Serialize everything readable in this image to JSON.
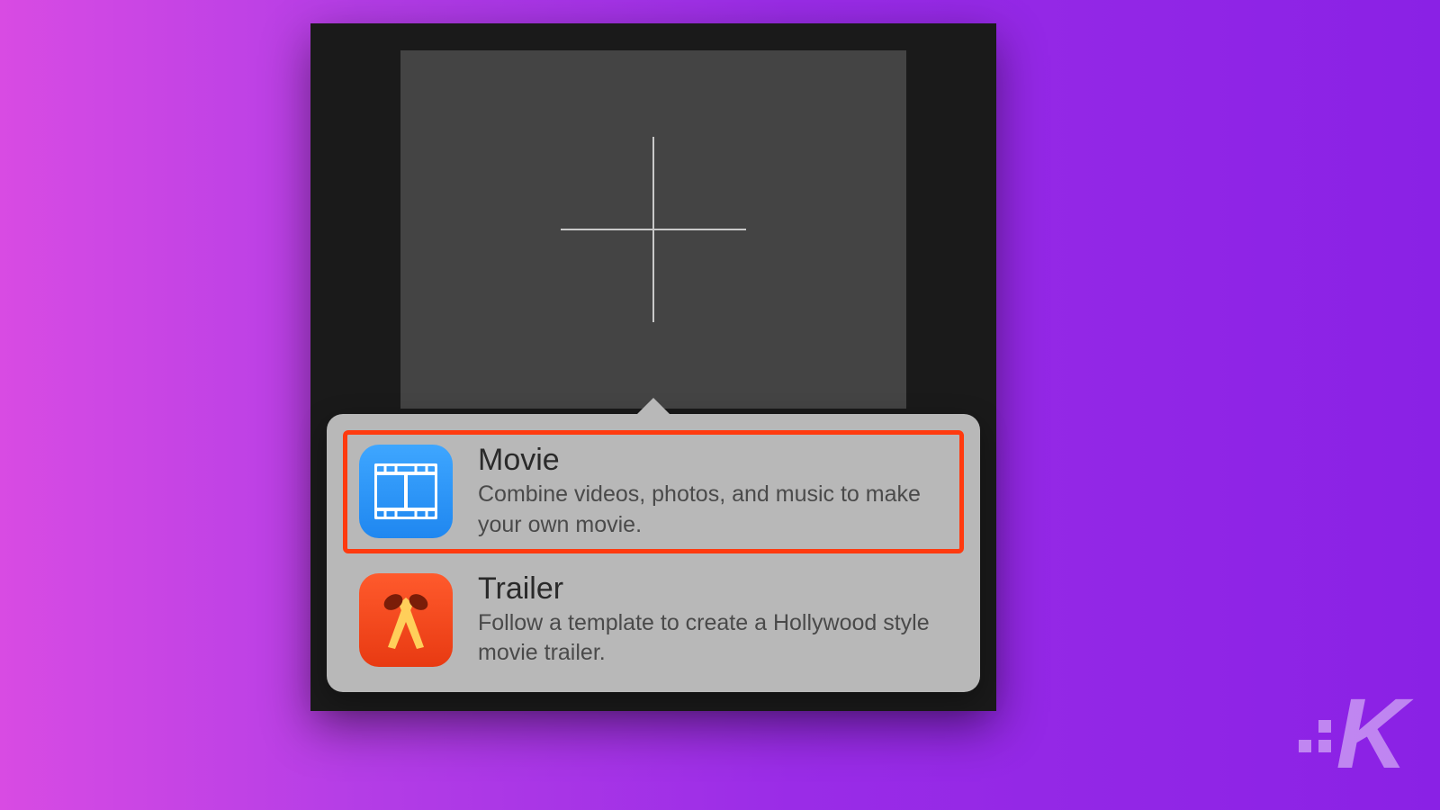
{
  "popover": {
    "options": [
      {
        "id": "movie",
        "title": "Movie",
        "description": "Combine videos, photos, and music to make your own movie.",
        "icon": "film-icon",
        "highlighted": true
      },
      {
        "id": "trailer",
        "title": "Trailer",
        "description": "Follow a template to create a Hollywood style movie trailer.",
        "icon": "spotlights-icon",
        "highlighted": false
      }
    ]
  },
  "watermark": {
    "letter": "K"
  },
  "colors": {
    "highlight_border": "#ff3a0f",
    "movie_icon_bg": "#1f87f0",
    "trailer_icon_bg": "#e83a12"
  }
}
